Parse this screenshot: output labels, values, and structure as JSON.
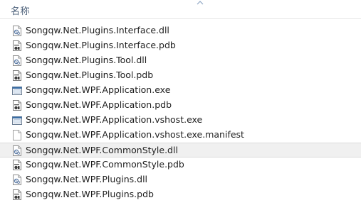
{
  "header": {
    "column_name": "名称",
    "sort": "ascending"
  },
  "files": [
    {
      "name": "Songqw.Net.Plugins.Interface.dll",
      "icon": "dll-file-icon"
    },
    {
      "name": "Songqw.Net.Plugins.Interface.pdb",
      "icon": "pdb-file-icon"
    },
    {
      "name": "Songqw.Net.Plugins.Tool.dll",
      "icon": "dll-file-icon"
    },
    {
      "name": "Songqw.Net.Plugins.Tool.pdb",
      "icon": "pdb-file-icon"
    },
    {
      "name": "Songqw.Net.WPF.Application.exe",
      "icon": "exe-file-icon"
    },
    {
      "name": "Songqw.Net.WPF.Application.pdb",
      "icon": "pdb-file-icon"
    },
    {
      "name": "Songqw.Net.WPF.Application.vshost.exe",
      "icon": "exe-file-icon"
    },
    {
      "name": "Songqw.Net.WPF.Application.vshost.exe.manifest",
      "icon": "blank-file-icon"
    },
    {
      "name": "Songqw.Net.WPF.CommonStyle.dll",
      "icon": "dll-file-icon",
      "selected": true
    },
    {
      "name": "Songqw.Net.WPF.CommonStyle.pdb",
      "icon": "pdb-file-icon"
    },
    {
      "name": "Songqw.Net.WPF.Plugins.dll",
      "icon": "dll-file-icon"
    },
    {
      "name": "Songqw.Net.WPF.Plugins.pdb",
      "icon": "pdb-file-icon"
    }
  ]
}
